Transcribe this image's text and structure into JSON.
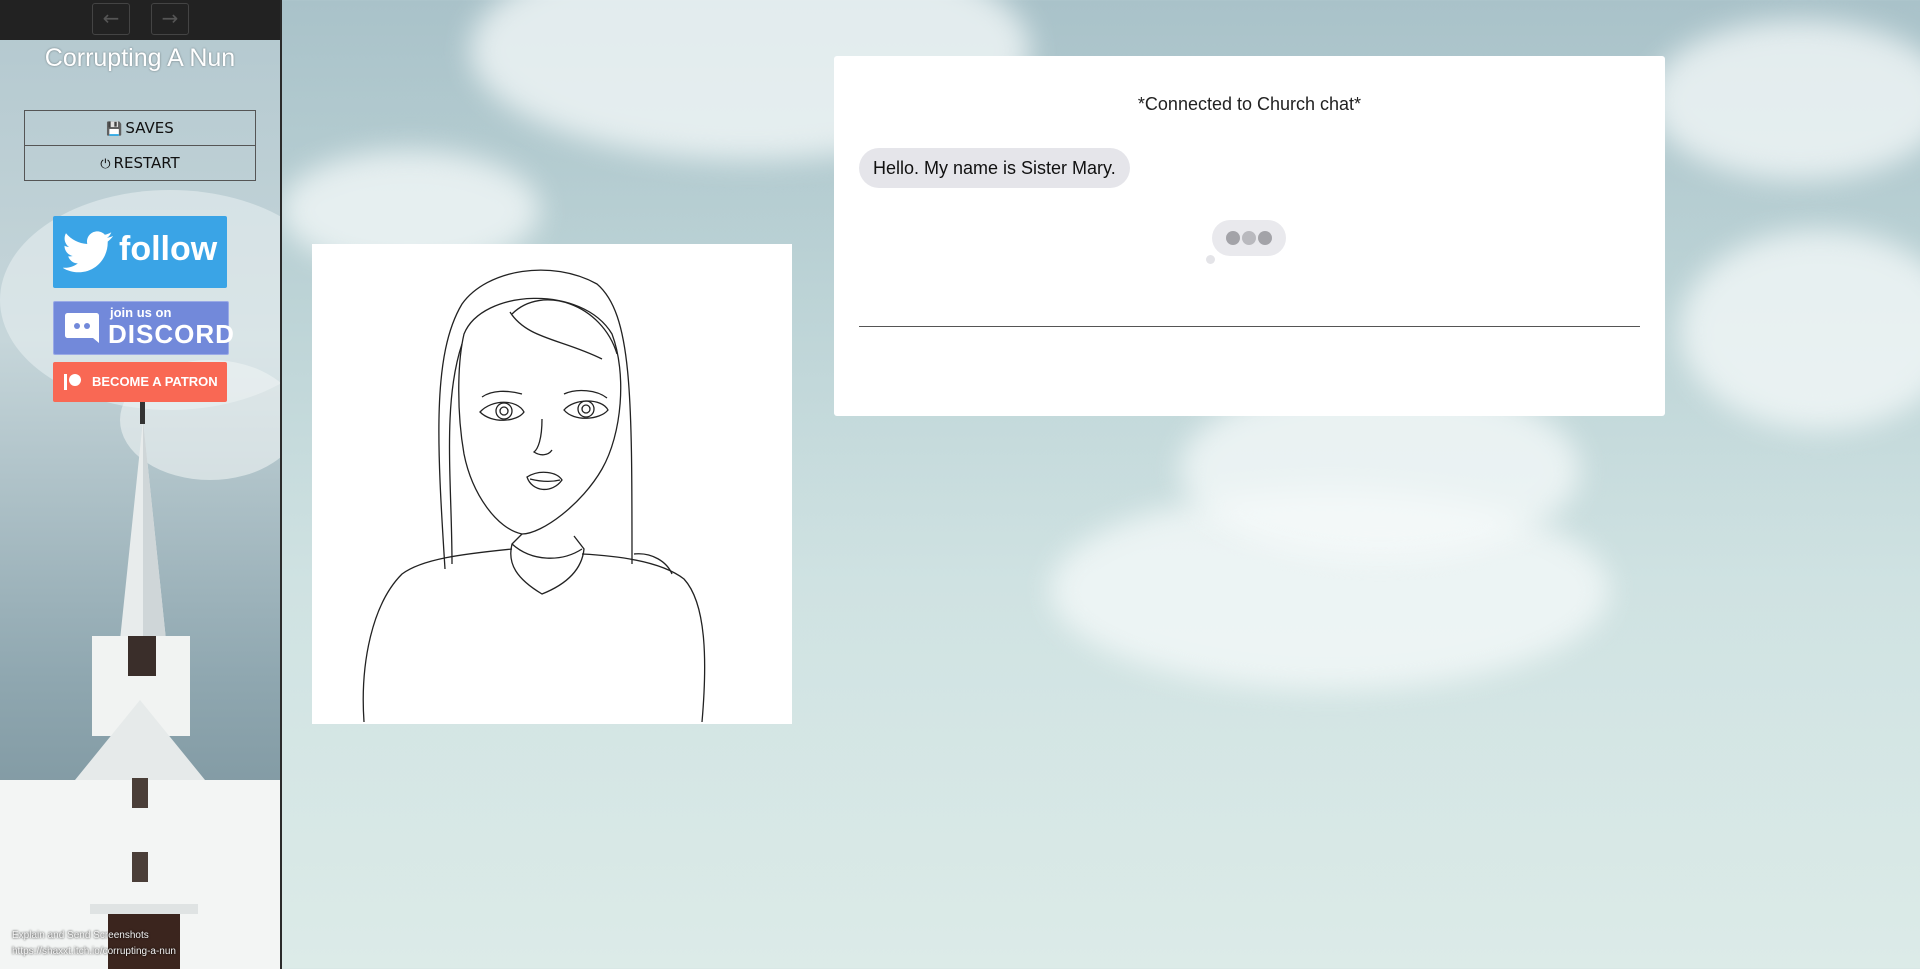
{
  "sidebar": {
    "nav_back_icon": "arrow-left",
    "nav_forward_icon": "arrow-right",
    "title": "Corrupting A Nun",
    "menu": [
      {
        "label": "SAVES",
        "icon": "floppy-disk-icon"
      },
      {
        "label": "RESTART",
        "icon": "power-icon"
      }
    ],
    "badges": {
      "twitter": {
        "label": "follow",
        "color": "#3aa4e6"
      },
      "discord": {
        "small": "join us on",
        "big": "DISCORD",
        "color": "#7289da"
      },
      "patreon": {
        "label": "BECOME A PATRON",
        "color": "#f96854"
      }
    },
    "footer": {
      "line1": "Explain and Send Screenshots",
      "line2": "https://shaxxt.itch.io/corrupting-a-nun"
    }
  },
  "chat": {
    "status": "*Connected to Church chat*",
    "messages": [
      {
        "text": "Hello. My name is Sister Mary."
      }
    ],
    "typing_indicator": true
  },
  "portrait": {
    "subject": "nun-sketch"
  }
}
